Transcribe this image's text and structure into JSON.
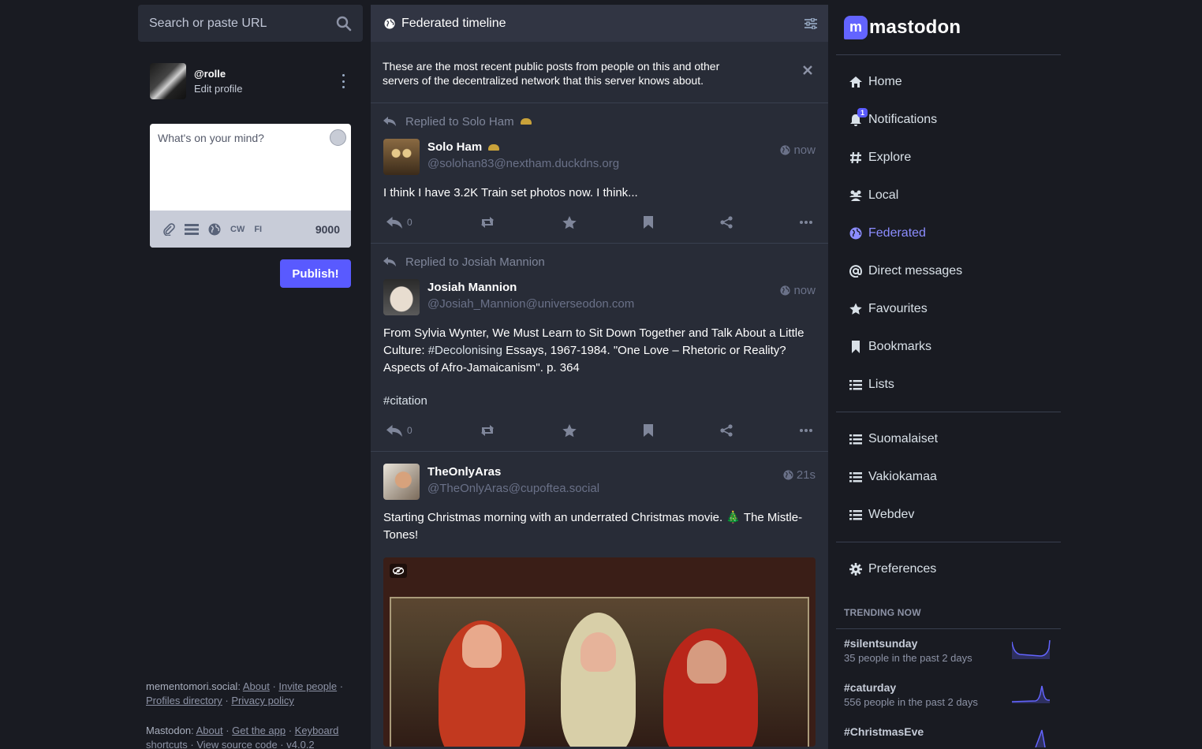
{
  "search": {
    "placeholder": "Search or paste URL"
  },
  "account": {
    "handle": "@rolle",
    "edit": "Edit profile"
  },
  "compose": {
    "placeholder": "What's on your mind?",
    "cw_label": "CW",
    "lang_label": "FI",
    "char_count": "9000",
    "publish_label": "Publish!"
  },
  "footer": {
    "server": "mementomori.social",
    "server_links": [
      "About",
      "Invite people",
      "Profiles directory",
      "Privacy policy"
    ],
    "mastodon": "Mastodon",
    "mastodon_links": [
      "About",
      "Get the app",
      "Keyboard shortcuts",
      "View source code"
    ],
    "version": "v4.0.2"
  },
  "timeline": {
    "title": "Federated timeline",
    "notice": "These are the most recent public posts from people on this and other servers of the decentralized network that this server knows about.",
    "posts": [
      {
        "prepend": "Replied to Solo Ham",
        "display_name": "Solo Ham",
        "acct": "@solohan83@nextham.duckdns.org",
        "time": "now",
        "content": "I think I have 3.2K Train set photos now. I think...",
        "replies": "0"
      },
      {
        "prepend": "Replied to Josiah Mannion",
        "display_name": "Josiah Mannion",
        "acct": "@Josiah_Mannion@universeodon.com",
        "time": "now",
        "content_before": "From Sylvia Wynter, We Must Learn to Sit Down Together and Talk About a Little Culture: ",
        "content_tag": "#Decolonising",
        "content_after": " Essays, 1967-1984. \"One Love – Rhetoric or Reality? Aspects of Afro-Jamaicanism\". p. 364",
        "content_tag2": "#citation",
        "replies": "0"
      },
      {
        "display_name": "TheOnlyAras",
        "acct": "@TheOnlyAras@cupoftea.social",
        "time": "21s",
        "content": "Starting Christmas morning with an underrated Christmas movie. 🎄 The Mistle-Tones!"
      }
    ]
  },
  "brand": {
    "name": "mastodon"
  },
  "nav": {
    "items": [
      {
        "label": "Home",
        "icon": "home-icon"
      },
      {
        "label": "Notifications",
        "icon": "bell-icon",
        "badge": "1"
      },
      {
        "label": "Explore",
        "icon": "hashtag-icon"
      },
      {
        "label": "Local",
        "icon": "users-icon"
      },
      {
        "label": "Federated",
        "icon": "globe-icon",
        "active": true
      },
      {
        "label": "Direct messages",
        "icon": "at-icon"
      },
      {
        "label": "Favourites",
        "icon": "star-icon"
      },
      {
        "label": "Bookmarks",
        "icon": "bookmark-icon"
      },
      {
        "label": "Lists",
        "icon": "list-icon"
      }
    ],
    "lists": [
      "Suomalaiset",
      "Vakiokamaa",
      "Webdev"
    ],
    "preferences": "Preferences"
  },
  "trending": {
    "title": "TRENDING NOW",
    "items": [
      {
        "tag": "#silentsunday",
        "sub": "35 people in the past 2 days"
      },
      {
        "tag": "#caturday",
        "sub": "556 people in the past 2 days"
      },
      {
        "tag": "#ChristmasEve",
        "sub": ""
      }
    ]
  },
  "colors": {
    "accent": "#595aff",
    "active_nav": "#8c8dff",
    "background": "#191b22",
    "column": "#282c37"
  }
}
